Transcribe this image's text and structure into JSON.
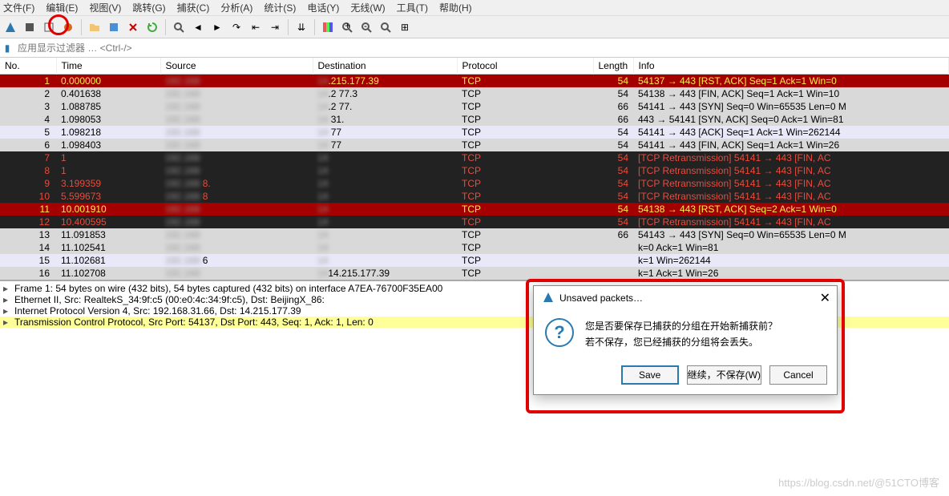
{
  "menu": {
    "file": "文件(F)",
    "edit": "编辑(E)",
    "view": "视图(V)",
    "go": "跳转(G)",
    "capture": "捕获(C)",
    "analyze": "分析(A)",
    "statistics": "统计(S)",
    "telephony": "电话(Y)",
    "wireless": "无线(W)",
    "tools": "工具(T)",
    "help": "帮助(H)"
  },
  "filter": {
    "placeholder": "应用显示过滤器 … <Ctrl-/>"
  },
  "columns": {
    "no": "No.",
    "time": "Time",
    "source": "Source",
    "destination": "Destination",
    "protocol": "Protocol",
    "length": "Length",
    "info": "Info"
  },
  "packets": [
    {
      "no": "1",
      "time": "0.000000",
      "src": "",
      "dst": ".215.177.39",
      "proto": "TCP",
      "len": "54",
      "info": "54137 → 443 [RST, ACK] Seq=1 Ack=1 Win=0",
      "style": "row-red-dark"
    },
    {
      "no": "2",
      "time": "0.401638",
      "src": "",
      "dst": ".2    77.3",
      "proto": "TCP",
      "len": "54",
      "info": "54138 → 443 [FIN, ACK] Seq=1 Ack=1 Win=10",
      "style": "row-gray"
    },
    {
      "no": "3",
      "time": "1.088785",
      "src": "",
      "dst": ".2    77.",
      "proto": "TCP",
      "len": "66",
      "info": "54141 → 443 [SYN] Seq=0 Win=65535 Len=0 M",
      "style": "row-gray"
    },
    {
      "no": "4",
      "time": "1.098053",
      "src": "",
      "dst": "   31.",
      "proto": "TCP",
      "len": "66",
      "info": "443 → 54141 [SYN, ACK] Seq=0 Ack=1 Win=81",
      "style": "row-gray"
    },
    {
      "no": "5",
      "time": "1.098218",
      "src": "",
      "dst": "   77",
      "proto": "TCP",
      "len": "54",
      "info": "54141 → 443 [ACK] Seq=1 Ack=1 Win=262144",
      "style": "row-lavender"
    },
    {
      "no": "6",
      "time": "1.098403",
      "src": "",
      "dst": "   77",
      "proto": "TCP",
      "len": "54",
      "info": "54141 → 443 [FIN, ACK] Seq=1 Ack=1 Win=26",
      "style": "row-gray"
    },
    {
      "no": "7",
      "time": "1",
      "src": "",
      "dst": "",
      "proto": "TCP",
      "len": "54",
      "info": "[TCP Retransmission] 54141 → 443 [FIN, AC",
      "style": "row-black"
    },
    {
      "no": "8",
      "time": "1",
      "src": "",
      "dst": "",
      "proto": "TCP",
      "len": "54",
      "info": "[TCP Retransmission] 54141 → 443 [FIN, AC",
      "style": "row-black"
    },
    {
      "no": "9",
      "time": "3.199359",
      "src": "    8.",
      "dst": "",
      "proto": "TCP",
      "len": "54",
      "info": "[TCP Retransmission] 54141 → 443 [FIN, AC",
      "style": "row-black"
    },
    {
      "no": "10",
      "time": "5.599673",
      "src": "    8",
      "dst": "",
      "proto": "TCP",
      "len": "54",
      "info": "[TCP Retransmission] 54141 → 443 [FIN, AC",
      "style": "row-black"
    },
    {
      "no": "11",
      "time": "10.001910",
      "src": "",
      "dst": "",
      "proto": "TCP",
      "len": "54",
      "info": "54138 → 443 [RST, ACK] Seq=2 Ack=1 Win=0",
      "style": "row-red-dark"
    },
    {
      "no": "12",
      "time": "10.400595",
      "src": "",
      "dst": "",
      "proto": "TCP",
      "len": "54",
      "info": "[TCP Retransmission] 54141 → 443 [FIN, AC",
      "style": "row-black"
    },
    {
      "no": "13",
      "time": "11.091853",
      "src": "",
      "dst": "",
      "proto": "TCP",
      "len": "66",
      "info": "54143 → 443 [SYN] Seq=0 Win=65535 Len=0 M",
      "style": "row-gray"
    },
    {
      "no": "14",
      "time": "11.102541",
      "src": "",
      "dst": "",
      "proto": "TCP",
      "len": "",
      "info": "k=0 Ack=1 Win=81",
      "style": "row-gray"
    },
    {
      "no": "15",
      "time": "11.102681",
      "src": "      6",
      "dst": "",
      "proto": "TCP",
      "len": "",
      "info": "k=1 Win=262144",
      "style": "row-lavender"
    },
    {
      "no": "16",
      "time": "11.102708",
      "src": "",
      "dst": "14.215.177.39",
      "proto": "TCP",
      "len": "",
      "info": "k=1 Ack=1 Win=26",
      "style": "row-gray"
    }
  ],
  "details": {
    "l1": "Frame 1: 54 bytes on wire (432 bits), 54 bytes captured (432 bits) on interface                           A7EA-76700F35EA00",
    "l2": "Ethernet II, Src: RealtekS_34:9f:c5 (00:e0:4c:34:9f:c5), Dst: BeijingX_86:",
    "l3": "Internet Protocol Version 4, Src: 192.168.31.66, Dst: 14.215.177.39",
    "l4": "Transmission Control Protocol, Src Port: 54137, Dst Port: 443, Seq: 1, Ack: 1, Len: 0"
  },
  "dialog": {
    "title": "Unsaved packets…",
    "line1": "您是否要保存已捕获的分组在开始新捕获前？",
    "line2": "若不保存，您已经捕获的分组将会丢失。",
    "save": "Save",
    "continue": "继续，不保存(W)",
    "cancel": "Cancel"
  },
  "watermark": "https://blog.csdn.net/@51CTO博客"
}
